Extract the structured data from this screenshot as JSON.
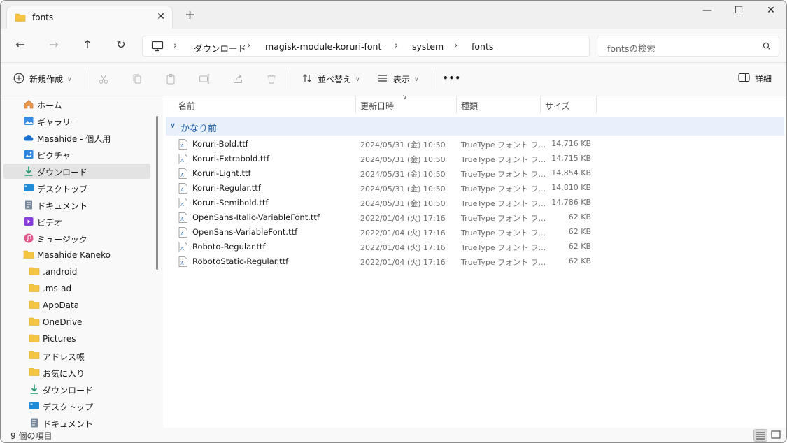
{
  "tab": {
    "title": "fonts",
    "close_glyph": "✕",
    "new_glyph": "+"
  },
  "window_controls": {
    "minimize": "—",
    "maximize": "☐",
    "close": "✕"
  },
  "nav": {
    "back": "←",
    "forward": "→",
    "up": "↑",
    "refresh": "↻"
  },
  "breadcrumb": [
    "ダウンロード",
    "magisk-module-koruri-font",
    "system",
    "fonts"
  ],
  "breadcrumb_separator": "›",
  "search": {
    "placeholder": "fontsの検索"
  },
  "commands": {
    "new": "新規作成",
    "sort": "並べ替え",
    "view": "表示",
    "more": "•••",
    "details": "詳細"
  },
  "sidebar": {
    "items": [
      {
        "label": "ホーム",
        "icon": "home-icon"
      },
      {
        "label": "ギャラリー",
        "icon": "gallery-icon"
      },
      {
        "label": "Masahide - 個人用",
        "icon": "cloud-icon"
      },
      {
        "label": "ピクチャ",
        "icon": "pictures-icon"
      },
      {
        "label": "ダウンロード",
        "icon": "download-icon",
        "selected": true
      },
      {
        "label": "デスクトップ",
        "icon": "desktop-icon"
      },
      {
        "label": "ドキュメント",
        "icon": "document-icon"
      },
      {
        "label": "ビデオ",
        "icon": "video-icon"
      },
      {
        "label": "ミュージック",
        "icon": "music-icon"
      },
      {
        "label": "Masahide Kaneko",
        "icon": "folder-icon"
      },
      {
        "label": ".android",
        "icon": "folder-icon"
      },
      {
        "label": ".ms-ad",
        "icon": "folder-icon"
      },
      {
        "label": "AppData",
        "icon": "folder-icon"
      },
      {
        "label": "OneDrive",
        "icon": "folder-icon"
      },
      {
        "label": "Pictures",
        "icon": "folder-icon"
      },
      {
        "label": "アドレス帳",
        "icon": "folder-icon"
      },
      {
        "label": "お気に入り",
        "icon": "folder-icon"
      },
      {
        "label": "ダウンロード",
        "icon": "download-icon"
      },
      {
        "label": "デスクトップ",
        "icon": "desktop-icon"
      },
      {
        "label": "ドキュメント",
        "icon": "document-icon"
      }
    ]
  },
  "columns": {
    "name": "名前",
    "modified": "更新日時",
    "type": "種類",
    "size": "サイズ"
  },
  "group": {
    "label": "かなり前",
    "chevron": "∨"
  },
  "files": [
    {
      "name": "Koruri-Bold.ttf",
      "modified": "2024/05/31 (金) 10:50",
      "type": "TrueType フォント フ...",
      "size": "14,716 KB"
    },
    {
      "name": "Koruri-Extrabold.ttf",
      "modified": "2024/05/31 (金) 10:50",
      "type": "TrueType フォント フ...",
      "size": "14,715 KB"
    },
    {
      "name": "Koruri-Light.ttf",
      "modified": "2024/05/31 (金) 10:50",
      "type": "TrueType フォント フ...",
      "size": "14,854 KB"
    },
    {
      "name": "Koruri-Regular.ttf",
      "modified": "2024/05/31 (金) 10:50",
      "type": "TrueType フォント フ...",
      "size": "14,810 KB"
    },
    {
      "name": "Koruri-Semibold.ttf",
      "modified": "2024/05/31 (金) 10:50",
      "type": "TrueType フォント フ...",
      "size": "14,786 KB"
    },
    {
      "name": "OpenSans-Italic-VariableFont.ttf",
      "modified": "2022/01/04 (火) 17:16",
      "type": "TrueType フォント フ...",
      "size": "62 KB"
    },
    {
      "name": "OpenSans-VariableFont.ttf",
      "modified": "2022/01/04 (火) 17:16",
      "type": "TrueType フォント フ...",
      "size": "62 KB"
    },
    {
      "name": "Roboto-Regular.ttf",
      "modified": "2022/01/04 (火) 17:16",
      "type": "TrueType フォント フ...",
      "size": "62 KB"
    },
    {
      "name": "RobotoStatic-Regular.ttf",
      "modified": "2022/01/04 (火) 17:16",
      "type": "TrueType フォント フ...",
      "size": "62 KB"
    }
  ],
  "status": {
    "count": "9 個の項目"
  },
  "colors": {
    "accent": "#1f5fa8",
    "group_bg": "#e8f1fb",
    "folder": "#f4c542",
    "selected_bg": "#e3e3e3"
  }
}
